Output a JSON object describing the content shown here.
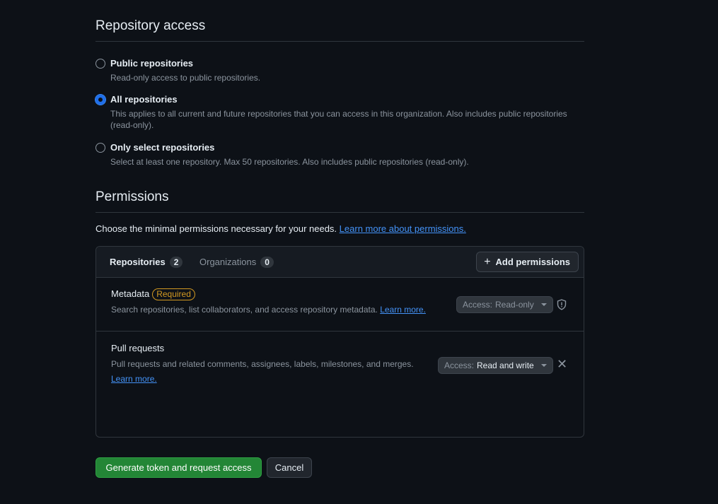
{
  "repository_access": {
    "title": "Repository access",
    "options": [
      {
        "label": "Public repositories",
        "description": "Read-only access to public repositories.",
        "checked": false
      },
      {
        "label": "All repositories",
        "description": "This applies to all current and future repositories that you can access in this organization. Also includes public repositories (read-only).",
        "checked": true
      },
      {
        "label": "Only select repositories",
        "description": "Select at least one repository. Max 50 repositories. Also includes public repositories (read-only).",
        "checked": false
      }
    ]
  },
  "permissions": {
    "title": "Permissions",
    "intro": "Choose the minimal permissions necessary for your needs.",
    "intro_link": "Learn more about permissions.",
    "tabs": [
      {
        "label": "Repositories",
        "count": "2"
      },
      {
        "label": "Organizations",
        "count": "0"
      }
    ],
    "add_button": "Add permissions",
    "rows": [
      {
        "name": "Metadata",
        "badge": "Required",
        "description": "Search repositories, list collaborators, and access repository metadata.",
        "link": "Learn more.",
        "access_prefix": "Access:",
        "access_value": "Read-only",
        "icon": "shield-icon"
      },
      {
        "name": "Pull requests",
        "description": "Pull requests and related comments, assignees, labels, milestones, and merges.",
        "link": "Learn more.",
        "access_prefix": "Access:",
        "access_value": "Read and write",
        "icon": "close-icon"
      }
    ]
  },
  "actions": {
    "primary": "Generate token and request access",
    "secondary": "Cancel"
  },
  "colors": {
    "background": "#0d1117",
    "primary_button": "#238636",
    "link": "#4493f8",
    "required_badge": "#d29922"
  }
}
